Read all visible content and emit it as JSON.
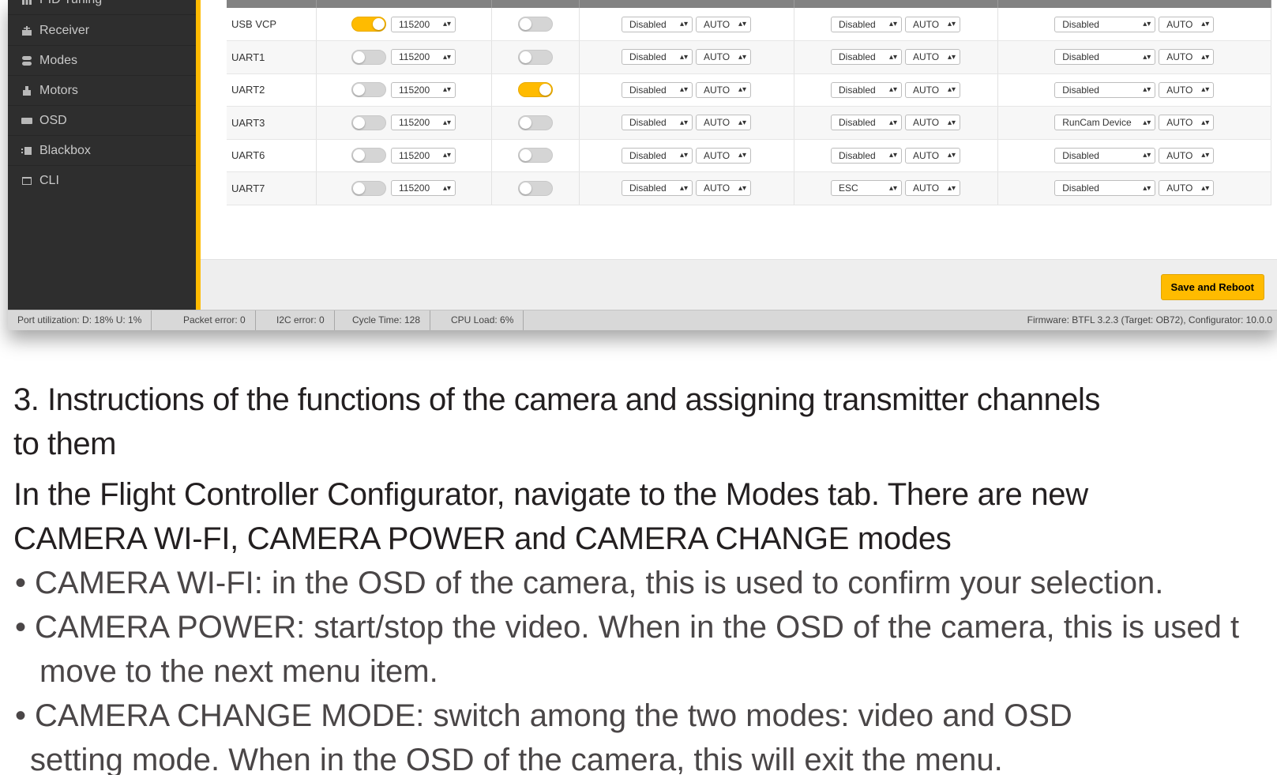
{
  "sidebar": {
    "items": [
      {
        "label": "PID Tuning",
        "icon": "pid-icon"
      },
      {
        "label": "Receiver",
        "icon": "receiver-icon"
      },
      {
        "label": "Modes",
        "icon": "modes-icon"
      },
      {
        "label": "Motors",
        "icon": "motors-icon"
      },
      {
        "label": "OSD",
        "icon": "osd-icon"
      },
      {
        "label": "Blackbox",
        "icon": "blackbox-icon"
      },
      {
        "label": "CLI",
        "icon": "cli-icon"
      }
    ]
  },
  "ports": {
    "rows": [
      {
        "id": "USB VCP",
        "msp": true,
        "baud": "115200",
        "rx": false,
        "tel": "Disabled",
        "tel_baud": "AUTO",
        "sens": "Disabled",
        "sens_baud": "AUTO",
        "per": "Disabled",
        "per_baud": "AUTO"
      },
      {
        "id": "UART1",
        "msp": false,
        "baud": "115200",
        "rx": false,
        "tel": "Disabled",
        "tel_baud": "AUTO",
        "sens": "Disabled",
        "sens_baud": "AUTO",
        "per": "Disabled",
        "per_baud": "AUTO"
      },
      {
        "id": "UART2",
        "msp": false,
        "baud": "115200",
        "rx": true,
        "tel": "Disabled",
        "tel_baud": "AUTO",
        "sens": "Disabled",
        "sens_baud": "AUTO",
        "per": "Disabled",
        "per_baud": "AUTO"
      },
      {
        "id": "UART3",
        "msp": false,
        "baud": "115200",
        "rx": false,
        "tel": "Disabled",
        "tel_baud": "AUTO",
        "sens": "Disabled",
        "sens_baud": "AUTO",
        "per": "RunCam Device",
        "per_baud": "AUTO"
      },
      {
        "id": "UART6",
        "msp": false,
        "baud": "115200",
        "rx": false,
        "tel": "Disabled",
        "tel_baud": "AUTO",
        "sens": "Disabled",
        "sens_baud": "AUTO",
        "per": "Disabled",
        "per_baud": "AUTO"
      },
      {
        "id": "UART7",
        "msp": false,
        "baud": "115200",
        "rx": false,
        "tel": "Disabled",
        "tel_baud": "AUTO",
        "sens": "ESC",
        "sens_baud": "AUTO",
        "per": "Disabled",
        "per_baud": "AUTO"
      }
    ]
  },
  "footer": {
    "save_label": "Save and Reboot"
  },
  "status": {
    "port_util": "Port utilization: D: 18% U: 1%",
    "packet_error": "Packet error: 0",
    "i2c_error": "I2C error: 0",
    "cycle_time": "Cycle Time: 128",
    "cpu_load": "CPU Load: 6%",
    "firmware": "Firmware: BTFL 3.2.3 (Target: OB72), Configurator: 10.0.0"
  },
  "doc": {
    "heading_line1": "3. Instructions of the functions of the camera and assigning transmitter channels",
    "heading_line2": "to them",
    "intro_line1": "In the Flight Controller Configurator, navigate to the Modes tab. There are new",
    "intro_line2": "CAMERA WI-FI, CAMERA POWER and CAMERA CHANGE modes",
    "bullet1": "CAMERA WI-FI: in the OSD of the camera, this is used to confirm your selection.",
    "bullet2_line1": "CAMERA POWER: start/stop the video. When in the OSD of the camera, this is used t",
    "bullet2_line2": "move to the next menu item.",
    "bullet3_line1": "CAMERA CHANGE MODE: switch among the two modes: video and OSD",
    "bullet3_line2": "setting mode. When in the OSD of the camera, this will exit the menu."
  },
  "colors": {
    "accent": "#ffbb00",
    "sidebar": "#2e2e2e",
    "header": "#828282"
  }
}
